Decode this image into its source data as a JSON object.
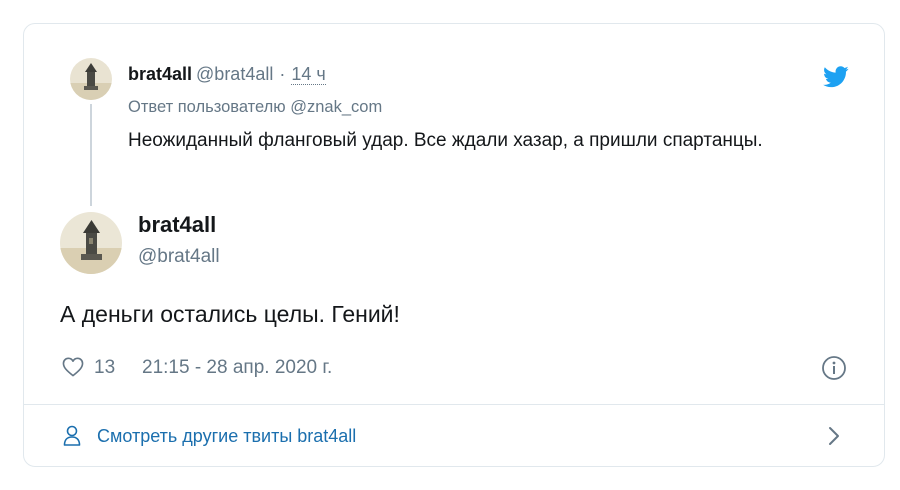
{
  "parent_tweet": {
    "name": "brat4all",
    "handle": "@brat4all",
    "separator": "·",
    "time": "14 ч",
    "reply_to": "Ответ пользователю @znak_com",
    "text": "Неожиданный фланговый удар. Все ждали хазар, а пришли спартанцы.",
    "avatar_icon": "avatar-photo"
  },
  "main_tweet": {
    "name": "brat4all",
    "handle": "@brat4all",
    "text": "А деньги остались целы. Гений!",
    "avatar_icon": "avatar-photo"
  },
  "meta": {
    "likes": "13",
    "timestamp": "21:15 - 28 апр. 2020 г.",
    "like_icon": "heart-icon",
    "info_icon": "info-icon"
  },
  "footer": {
    "link_text": "Смотреть другие твиты brat4all",
    "icon": "person-icon",
    "chevron": "chevron-right-icon"
  },
  "brand": {
    "icon": "twitter-bird-icon",
    "color": "#1da1f2"
  },
  "colors": {
    "text_primary": "#14171a",
    "text_secondary": "#657786",
    "link": "#1b6fae",
    "border": "#e1e8ed"
  }
}
